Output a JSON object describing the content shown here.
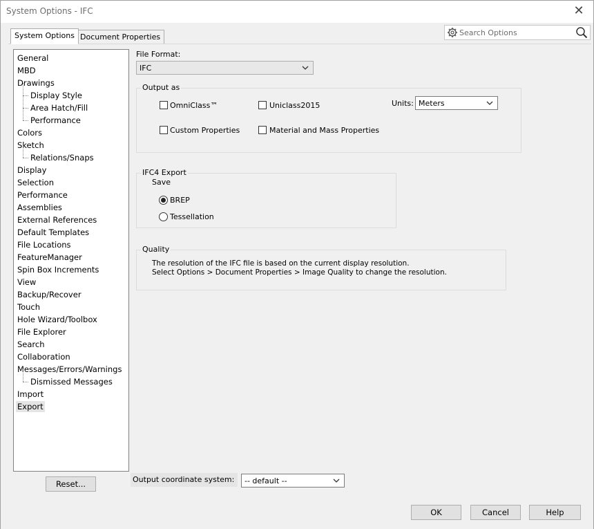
{
  "window": {
    "title": "System Options - IFC"
  },
  "tabs": [
    {
      "label": "System Options",
      "active": true
    },
    {
      "label": "Document Properties",
      "active": false
    }
  ],
  "search": {
    "placeholder": "Search Options"
  },
  "tree": [
    {
      "label": "General",
      "level": 0
    },
    {
      "label": "MBD",
      "level": 0
    },
    {
      "label": "Drawings",
      "level": 0
    },
    {
      "label": "Display Style",
      "level": 1
    },
    {
      "label": "Area Hatch/Fill",
      "level": 1
    },
    {
      "label": "Performance",
      "level": 1
    },
    {
      "label": "Colors",
      "level": 0
    },
    {
      "label": "Sketch",
      "level": 0
    },
    {
      "label": "Relations/Snaps",
      "level": 1
    },
    {
      "label": "Display",
      "level": 0
    },
    {
      "label": "Selection",
      "level": 0
    },
    {
      "label": "Performance",
      "level": 0
    },
    {
      "label": "Assemblies",
      "level": 0
    },
    {
      "label": "External References",
      "level": 0
    },
    {
      "label": "Default Templates",
      "level": 0
    },
    {
      "label": "File Locations",
      "level": 0
    },
    {
      "label": "FeatureManager",
      "level": 0
    },
    {
      "label": "Spin Box Increments",
      "level": 0
    },
    {
      "label": "View",
      "level": 0
    },
    {
      "label": "Backup/Recover",
      "level": 0
    },
    {
      "label": "Touch",
      "level": 0
    },
    {
      "label": "Hole Wizard/Toolbox",
      "level": 0
    },
    {
      "label": "File Explorer",
      "level": 0
    },
    {
      "label": "Search",
      "level": 0
    },
    {
      "label": "Collaboration",
      "level": 0
    },
    {
      "label": "Messages/Errors/Warnings",
      "level": 0
    },
    {
      "label": "Dismissed Messages",
      "level": 1
    },
    {
      "label": "Import",
      "level": 0
    },
    {
      "label": "Export",
      "level": 0,
      "selected": true
    }
  ],
  "reset_label": "Reset...",
  "file_format": {
    "label": "File Format:",
    "value": "IFC"
  },
  "output_as": {
    "title": "Output as",
    "omniclass": {
      "label": "OmniClass™",
      "checked": false
    },
    "uniclass": {
      "label": "Uniclass2015",
      "checked": false
    },
    "custom_props": {
      "label": "Custom Properties",
      "checked": false
    },
    "material_mass": {
      "label": "Material and Mass Properties",
      "checked": false
    },
    "units_label": "Units:",
    "units_value": "Meters"
  },
  "ifc4": {
    "title": "IFC4 Export",
    "save_label": "Save",
    "brep": {
      "label": "BREP",
      "selected": true
    },
    "tessellation": {
      "label": "Tessellation",
      "selected": false
    }
  },
  "quality": {
    "title": "Quality",
    "line1": "The resolution of the IFC file is based on the current display resolution.",
    "line2": "Select Options > Document Properties > Image Quality to change the resolution."
  },
  "coord_system": {
    "label": "Output coordinate system:",
    "value": "-- default --"
  },
  "buttons": {
    "ok": "OK",
    "cancel": "Cancel",
    "help": "Help"
  }
}
